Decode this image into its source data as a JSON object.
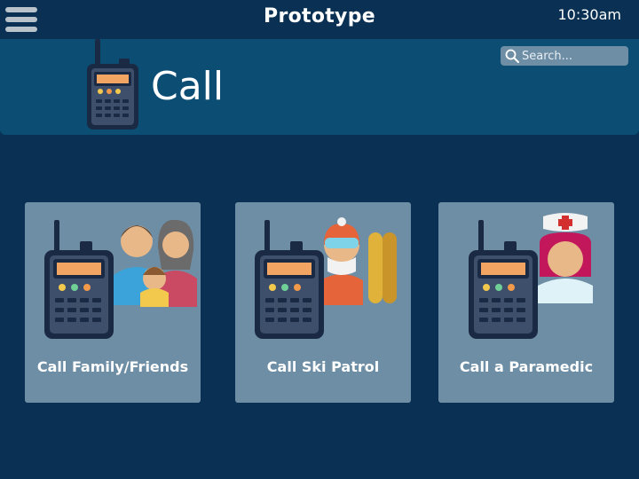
{
  "app": {
    "title": "Prototype",
    "time": "10:30am"
  },
  "header": {
    "title": "Call",
    "icon": "walkie-talkie-icon"
  },
  "search": {
    "placeholder": "Search..."
  },
  "options": [
    {
      "label": "Call Family/Friends",
      "icon": "family-icon"
    },
    {
      "label": "Call Ski Patrol",
      "icon": "ski-patrol-icon"
    },
    {
      "label": "Call a Paramedic",
      "icon": "paramedic-icon"
    }
  ],
  "colors": {
    "background": "#0a3153",
    "header_band": "#0b4d73",
    "card": "#6e8ea5",
    "text": "#ffffff"
  }
}
